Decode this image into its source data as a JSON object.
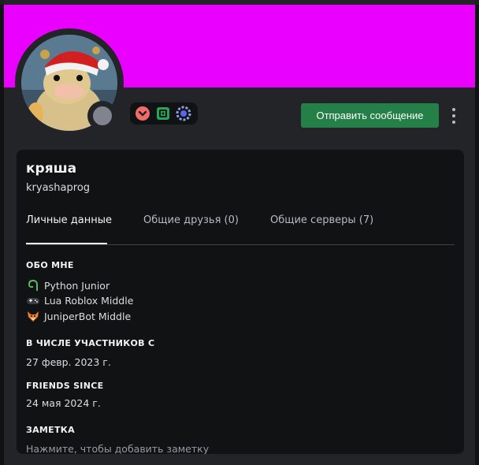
{
  "profile": {
    "display_name": "кряша",
    "username": "kryashaprog",
    "banner_color": "#ea00ff",
    "status": "offline"
  },
  "actions": {
    "send_message_label": "Отправить сообщение",
    "more_icon": "more-vertical-icon"
  },
  "badges": [
    {
      "icon": "chevron-down-badge-icon",
      "color": "#f26b6b"
    },
    {
      "icon": "nitro-badge-icon",
      "color": "#23a55a"
    },
    {
      "icon": "quest-badge-icon",
      "color": "#5865f2"
    }
  ],
  "tabs": [
    {
      "label": "Личные данные",
      "active": true
    },
    {
      "label": "Общие друзья (0)",
      "active": false
    },
    {
      "label": "Общие серверы (7)",
      "active": false
    }
  ],
  "about": {
    "heading": "ОБО МНЕ",
    "lines": [
      {
        "icon": "python-icon",
        "text": "Python Junior"
      },
      {
        "icon": "gamepad-icon",
        "text": "Lua Roblox Middle"
      },
      {
        "icon": "fox-icon",
        "text": "JuniperBot Middle"
      }
    ]
  },
  "member_since": {
    "heading": "В ЧИСЛЕ УЧАСТНИКОВ С",
    "value": "27 февр. 2023 г."
  },
  "friends_since": {
    "heading": "FRIENDS SINCE",
    "value": "24 мая 2024 г."
  },
  "note": {
    "heading": "ЗАМЕТКА",
    "placeholder": "Нажмите, чтобы добавить заметку"
  }
}
